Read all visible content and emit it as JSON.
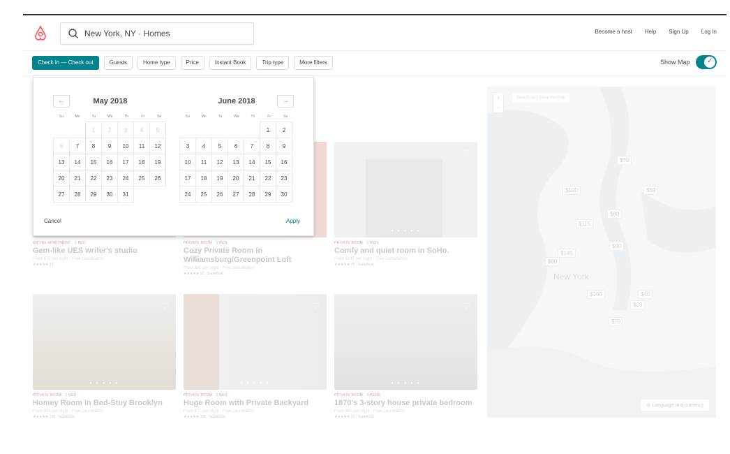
{
  "header": {
    "search_text": "New York, NY · Homes",
    "nav": [
      "Become a host",
      "Help",
      "Sign Up",
      "Log In"
    ]
  },
  "filters": [
    "Check in — Check out",
    "Guests",
    "Home type",
    "Price",
    "Instant Book",
    "Trip type",
    "More filters"
  ],
  "show_map_label": "Show Map",
  "colors": {
    "accent": "#00838a",
    "brand": "#ff5a5f"
  },
  "listings": [
    {
      "type": "ENTIRE APARTMENT · 1 BED",
      "title": "Gem-like UES writer's studio",
      "price": "From $75 per night · Free cancellation",
      "rating": "★★★★★ 23"
    },
    {
      "type": "PRIVATE ROOM · 1 BED",
      "title": "Cozy Private Room in Williamsburg/Greenpoint Loft",
      "price": "From $90 per night · Free cancellation",
      "rating": "★★★★★ 52 · Superhost"
    },
    {
      "type": "PRIVATE ROOM · 1 BED",
      "title": "Comfy and quiet room in SoHo.",
      "price": "From $145 per night · Free cancellation",
      "rating": "★★★★★ 75 · Superhost"
    },
    {
      "type": "PRIVATE ROOM · 1 BED",
      "title": "Homey Room in Bed-Stuy Brooklyn",
      "price": "From $59 per night · Free cancellation",
      "rating": "★★★★★ 126 · Superhost"
    },
    {
      "type": "PRIVATE ROOM · 1 BED",
      "title": "Huge Room with Private Backyard",
      "price": "From $70 per night · Free cancellation",
      "rating": "★★★★★ 105 · Superhost"
    },
    {
      "type": "PRIVATE ROOM · 2 BEDS",
      "title": "1870's 3-story house private bedroom",
      "price": "From $80 per night · Free cancellation",
      "rating": "★★★★★ 22 · Superhost"
    }
  ],
  "map": {
    "search_checkbox": "Search as I move the map",
    "city_label": "New York",
    "pins": [
      "$70",
      "$100",
      "$59",
      "$80",
      "$115",
      "$90",
      "$145",
      "$90",
      "$160",
      "$40",
      "$29",
      "$70"
    ],
    "language_button": "Language and currency"
  },
  "datepicker": {
    "prev_icon": "←",
    "next_icon": "→",
    "weekdays": [
      "Su",
      "Mo",
      "Tu",
      "We",
      "Th",
      "Fr",
      "Sa"
    ],
    "months": [
      {
        "title": "May 2018",
        "weeks": [
          [
            "",
            "",
            "1",
            "2",
            "3",
            "4",
            "5"
          ],
          [
            "6",
            "7",
            "8",
            "9",
            "10",
            "11",
            "12"
          ],
          [
            "13",
            "14",
            "15",
            "16",
            "17",
            "18",
            "19"
          ],
          [
            "20",
            "21",
            "22",
            "23",
            "24",
            "25",
            "26"
          ],
          [
            "27",
            "28",
            "29",
            "30",
            "31",
            "",
            ""
          ]
        ],
        "past_days": [
          "1",
          "2",
          "3",
          "4",
          "5",
          "6"
        ]
      },
      {
        "title": "June 2018",
        "weeks": [
          [
            "",
            "",
            "",
            "",
            "",
            "1",
            "2"
          ],
          [
            "3",
            "4",
            "5",
            "6",
            "7",
            "8",
            "9"
          ],
          [
            "10",
            "11",
            "12",
            "13",
            "14",
            "15",
            "16"
          ],
          [
            "17",
            "18",
            "19",
            "20",
            "21",
            "22",
            "23"
          ],
          [
            "24",
            "25",
            "26",
            "27",
            "28",
            "29",
            "30"
          ]
        ],
        "past_days": []
      }
    ],
    "cancel_label": "Cancel",
    "apply_label": "Apply"
  }
}
